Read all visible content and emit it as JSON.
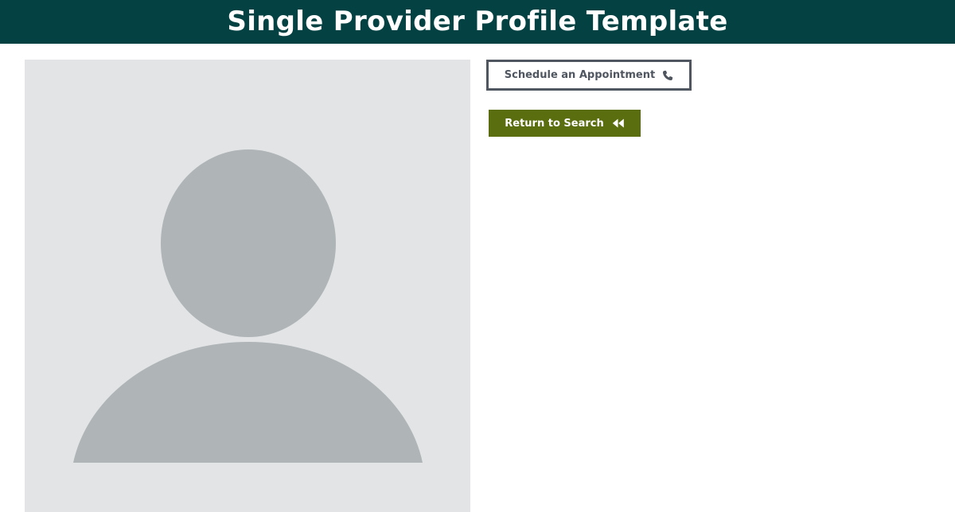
{
  "header": {
    "title": "Single Provider Profile Template"
  },
  "profile": {
    "photo_icon": "person-placeholder-icon"
  },
  "actions": {
    "schedule_label": "Schedule an Appointment",
    "schedule_icon": "phone-icon",
    "return_label": "Return to Search",
    "return_icon": "double-chevron-left-icon"
  },
  "colors": {
    "header_bg": "#044142",
    "return_button_bg": "#5a6e0f",
    "schedule_border": "#4f5660",
    "photo_bg": "#e3e4e6",
    "placeholder_fill": "#afb4b7"
  }
}
